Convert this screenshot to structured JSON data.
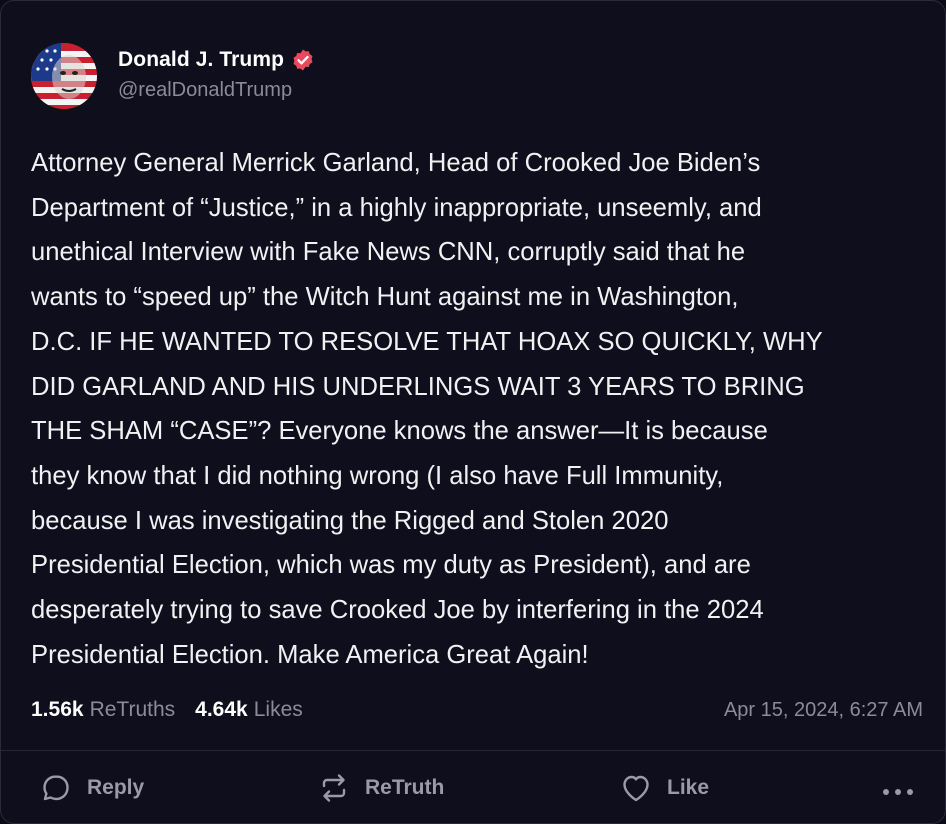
{
  "post": {
    "author": {
      "name": "Donald J. Trump",
      "handle": "@realDonaldTrump",
      "verified": true,
      "avatar_icon": "avatar-flag-face"
    },
    "text": "Attorney General Merrick Garland, Head of Crooked Joe Biden’s\nDepartment of “Justice,” in a highly inappropriate, unseemly, and\nunethical Interview with Fake News CNN, corruptly said that he\nwants to “speed up” the Witch Hunt against me in Washington,\nD.C. IF HE WANTED TO RESOLVE THAT HOAX SO QUICKLY, WHY\nDID GARLAND AND HIS UNDERLINGS WAIT 3 YEARS TO BRING\nTHE SHAM “CASE”? Everyone knows the answer—It is because\nthey know that I did nothing wrong (I also have Full Immunity,\nbecause I was investigating the Rigged and Stolen 2020\nPresidential Election, which was my duty as President), and are\ndesperately trying to save Crooked Joe by interfering in the 2024\nPresidential Election. Make America Great Again!",
    "stats": {
      "retruths_count": "1.56k",
      "retruths_label": "ReTruths",
      "likes_count": "4.64k",
      "likes_label": "Likes"
    },
    "timestamp": "Apr 15, 2024, 6:27 AM"
  },
  "actions": {
    "reply_label": "Reply",
    "retruth_label": "ReTruth",
    "like_label": "Like",
    "more_icon": "more-dots-icon"
  },
  "colors": {
    "background": "#0e0e1c",
    "text": "#f1f1f4",
    "muted": "#8b8b99",
    "verified_badge": "#e8495c"
  }
}
